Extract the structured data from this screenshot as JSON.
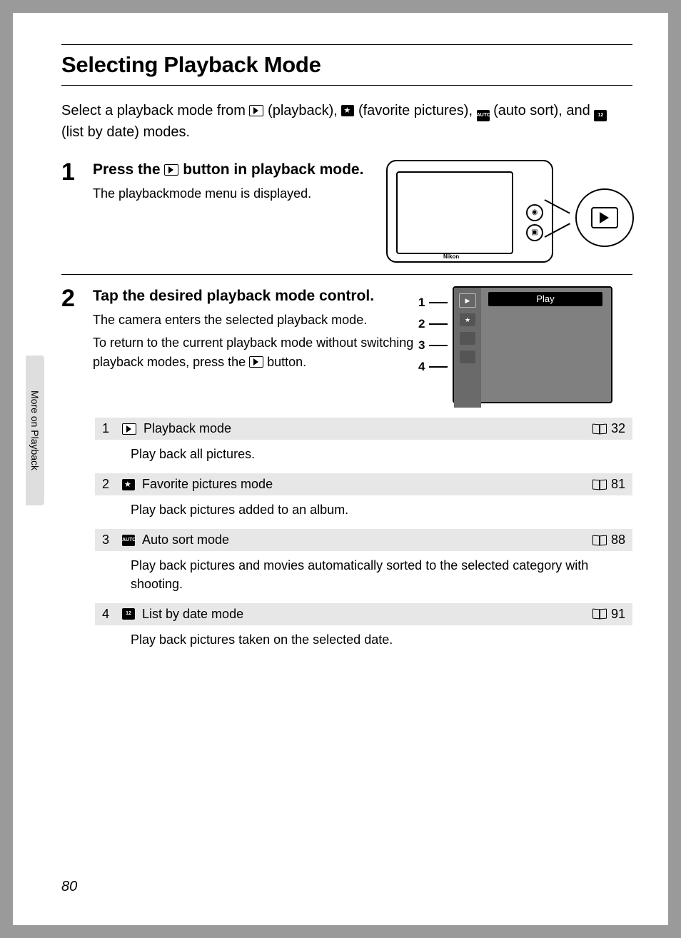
{
  "title": "Selecting Playback Mode",
  "intro": {
    "part1": "Select a playback mode from ",
    "playback": " (playback), ",
    "fav": " (favorite pictures), ",
    "auto": " (auto sort), and ",
    "date": " (list by date) modes."
  },
  "sidebar_tab": "More on Playback",
  "step1": {
    "num": "1",
    "head_a": "Press the ",
    "head_b": " button in playback mode.",
    "sub": "The playbackmode menu is displayed.",
    "camera_brand": "Nikon"
  },
  "step2": {
    "num": "2",
    "head": "Tap the desired playback mode control.",
    "sub1": "The camera enters the selected playback mode.",
    "sub2_a": "To return to the current playback mode without switching playback modes, press the ",
    "sub2_b": " button.",
    "lcd_label": "Play",
    "callouts": {
      "n1": "1",
      "n2": "2",
      "n3": "3",
      "n4": "4"
    }
  },
  "modes": [
    {
      "n": "1",
      "label": "Playback mode",
      "page": "32",
      "desc": "Play back all pictures.",
      "icon": "play"
    },
    {
      "n": "2",
      "label": "Favorite pictures mode",
      "page": "81",
      "desc": "Play back pictures added to an album.",
      "icon": "star"
    },
    {
      "n": "3",
      "label": "Auto sort mode",
      "page": "88",
      "desc": "Play back pictures and movies automatically sorted to the selected category with shooting.",
      "icon": "auto"
    },
    {
      "n": "4",
      "label": "List by date mode",
      "page": "91",
      "desc": "Play back pictures taken on the selected date.",
      "icon": "date"
    }
  ],
  "page_number": "80"
}
